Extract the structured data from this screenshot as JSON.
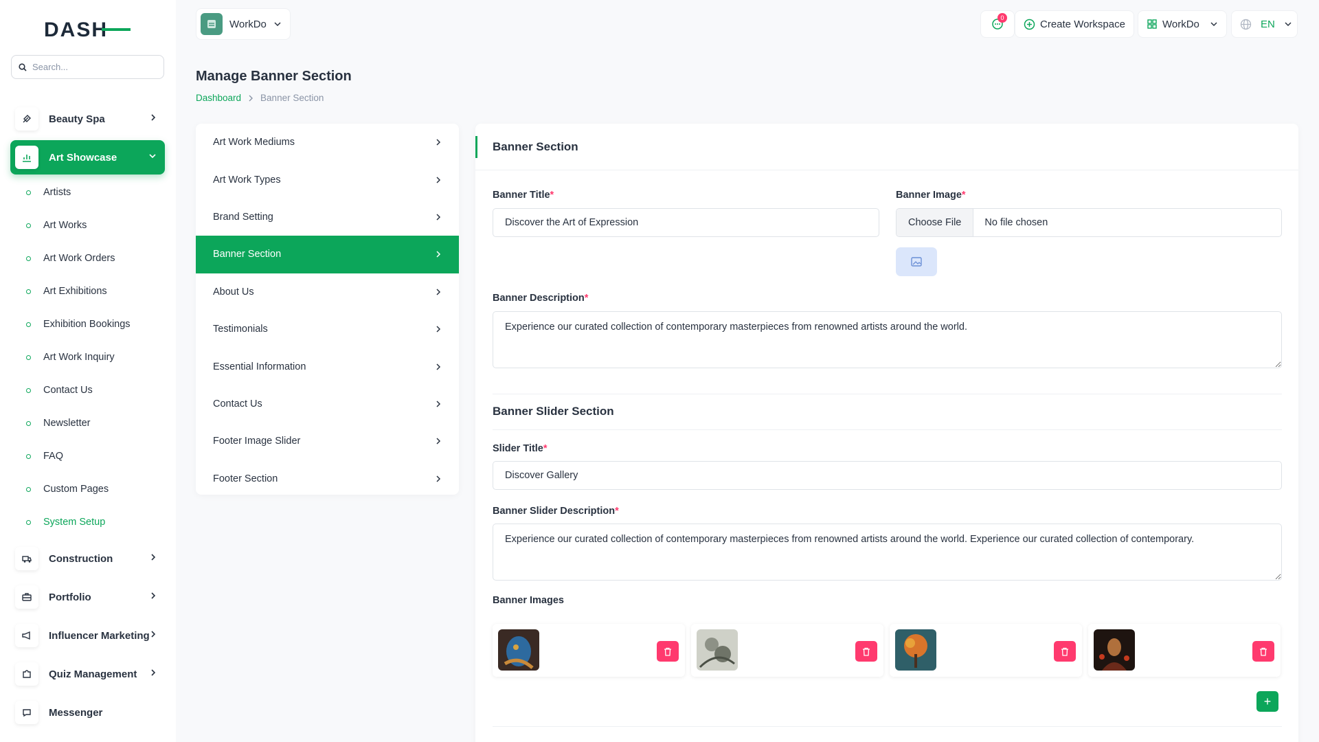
{
  "sidebar": {
    "search_placeholder": "Search...",
    "items": [
      {
        "label": "Beauty Spa",
        "icon": "brush-icon"
      },
      {
        "label": "Art Showcase",
        "icon": "chart-icon"
      },
      {
        "label": "Construction",
        "icon": "truck-icon"
      },
      {
        "label": "Portfolio",
        "icon": "briefcase-icon"
      },
      {
        "label": "Influencer Marketing",
        "icon": "megaphone-icon"
      },
      {
        "label": "Quiz Management",
        "icon": "puzzle-icon"
      },
      {
        "label": "Messenger",
        "icon": "chat-icon"
      }
    ],
    "subitems": [
      "Artists",
      "Art Works",
      "Art Work Orders",
      "Art Exhibitions",
      "Exhibition Bookings",
      "Art Work Inquiry",
      "Contact Us",
      "Newsletter",
      "FAQ",
      "Custom Pages",
      "System Setup"
    ]
  },
  "topbar": {
    "workspace": "WorkDo",
    "message_count": "0",
    "create_workspace": "Create Workspace",
    "workspace_switch": "WorkDo",
    "language": "EN"
  },
  "header": {
    "title": "Manage Banner Section",
    "breadcrumb": [
      "Dashboard",
      "Banner Section"
    ]
  },
  "settings_menu": [
    "Art Work Mediums",
    "Art Work Types",
    "Brand Setting",
    "Banner Section",
    "About Us",
    "Testimonials",
    "Essential Information",
    "Contact Us",
    "Footer Image Slider",
    "Footer Section"
  ],
  "card": {
    "title": "Banner Section",
    "banner_title_label": "Banner Title",
    "banner_title_value": "Discover the Art of Expression",
    "banner_image_label": "Banner Image",
    "choose_file": "Choose File",
    "no_file": "No file chosen",
    "banner_desc_label": "Banner Description",
    "banner_desc_value": "Experience our curated collection of contemporary masterpieces from renowned artists around the world.",
    "slider_section_title": "Banner Slider Section",
    "slider_title_label": "Slider Title",
    "slider_title_value": "Discover Gallery",
    "slider_desc_label": "Banner Slider Description",
    "slider_desc_value": "Experience our curated collection of contemporary masterpieces from renowned artists around the world. Experience our curated collection of contemporary.",
    "banner_images_label": "Banner Images",
    "required_mark": "*"
  },
  "colors": {
    "accent": "#0ca65a",
    "danger": "#ff3a6e"
  }
}
